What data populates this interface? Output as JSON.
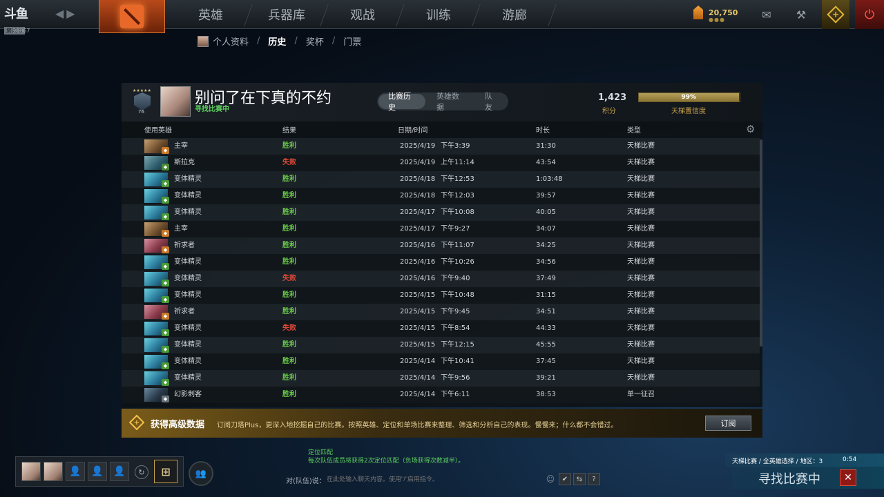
{
  "topbar": {
    "logo_text": "斗鱼",
    "logo_sub": "房间号",
    "room_id": "98067",
    "nav": [
      "英雄",
      "兵器库",
      "观战",
      "训练",
      "游廊"
    ],
    "gold": "20,750",
    "gold_dots": "●●●",
    "icons": [
      "mail-icon",
      "armory-icon",
      "plus-icon",
      "power-icon"
    ]
  },
  "subnav": {
    "items": [
      "个人资料",
      "历史",
      "奖杯",
      "门票"
    ],
    "active": "历史"
  },
  "profile": {
    "name": "别问了在下真的不约",
    "status": "寻找比赛中",
    "rank_number": "76",
    "tabs": [
      "比赛历史",
      "英雄数据",
      "队友"
    ],
    "active_tab": "比赛历史",
    "score": "1,423",
    "score_label": "积分",
    "confidence_percent": 99,
    "confidence_text": "99%",
    "confidence_label": "天梯置信度"
  },
  "table": {
    "headers": [
      "使用英雄",
      "结果",
      "日期/时间",
      "时长",
      "类型"
    ],
    "rows": [
      {
        "hero": "主宰",
        "result": "胜利",
        "date": "2025/4/19",
        "time": "下午3:39",
        "duration": "31:30",
        "type": "天梯比赛"
      },
      {
        "hero": "斯拉克",
        "result": "失败",
        "date": "2025/4/19",
        "time": "上午11:14",
        "duration": "43:54",
        "type": "天梯比赛"
      },
      {
        "hero": "变体精灵",
        "result": "胜利",
        "date": "2025/4/18",
        "time": "下午12:53",
        "duration": "1:03:48",
        "type": "天梯比赛"
      },
      {
        "hero": "变体精灵",
        "result": "胜利",
        "date": "2025/4/18",
        "time": "下午12:03",
        "duration": "39:57",
        "type": "天梯比赛"
      },
      {
        "hero": "变体精灵",
        "result": "胜利",
        "date": "2025/4/17",
        "time": "下午10:08",
        "duration": "40:05",
        "type": "天梯比赛"
      },
      {
        "hero": "主宰",
        "result": "胜利",
        "date": "2025/4/17",
        "time": "下午9:27",
        "duration": "34:07",
        "type": "天梯比赛"
      },
      {
        "hero": "祈求者",
        "result": "胜利",
        "date": "2025/4/16",
        "time": "下午11:07",
        "duration": "34:25",
        "type": "天梯比赛"
      },
      {
        "hero": "变体精灵",
        "result": "胜利",
        "date": "2025/4/16",
        "time": "下午10:26",
        "duration": "34:56",
        "type": "天梯比赛"
      },
      {
        "hero": "变体精灵",
        "result": "失败",
        "date": "2025/4/16",
        "time": "下午9:40",
        "duration": "37:49",
        "type": "天梯比赛"
      },
      {
        "hero": "变体精灵",
        "result": "胜利",
        "date": "2025/4/15",
        "time": "下午10:48",
        "duration": "31:15",
        "type": "天梯比赛"
      },
      {
        "hero": "祈求者",
        "result": "胜利",
        "date": "2025/4/15",
        "time": "下午9:45",
        "duration": "34:51",
        "type": "天梯比赛"
      },
      {
        "hero": "变体精灵",
        "result": "失败",
        "date": "2025/4/15",
        "time": "下午8:54",
        "duration": "44:33",
        "type": "天梯比赛"
      },
      {
        "hero": "变体精灵",
        "result": "胜利",
        "date": "2025/4/15",
        "time": "下午12:15",
        "duration": "45:55",
        "type": "天梯比赛"
      },
      {
        "hero": "变体精灵",
        "result": "胜利",
        "date": "2025/4/14",
        "time": "下午10:41",
        "duration": "37:45",
        "type": "天梯比赛"
      },
      {
        "hero": "变体精灵",
        "result": "胜利",
        "date": "2025/4/14",
        "time": "下午9:56",
        "duration": "39:21",
        "type": "天梯比赛"
      },
      {
        "hero": "幻影刺客",
        "result": "胜利",
        "date": "2025/4/14",
        "time": "下午6:11",
        "duration": "38:53",
        "type": "单一征召"
      }
    ]
  },
  "plus_banner": {
    "title": "获得高级数据",
    "description": "订阅刀塔Plus，更深入地挖掘自己的比赛。按照英雄、定位和单场比赛来整理、筛选和分析自己的表现。慢慢来；什么都不会错过。",
    "button": "订阅"
  },
  "chat": {
    "line1": "定位匹配",
    "line2": "每次队伍成员将获得2次定位匹配（负场获得次数减半）。",
    "prompt": "对(队伍)说：",
    "placeholder": "在此处输入聊天内容。使用\"/\"启用指令。"
  },
  "matchmaking": {
    "info": "天梯比赛 / 全英雄选择 / 地区：3",
    "timer": "0:54",
    "status": "寻找比赛中",
    "cancel": "✕"
  },
  "colors": {
    "win": "#6ccf4a",
    "loss": "#e24a3a",
    "gold": "#c9a24a"
  }
}
